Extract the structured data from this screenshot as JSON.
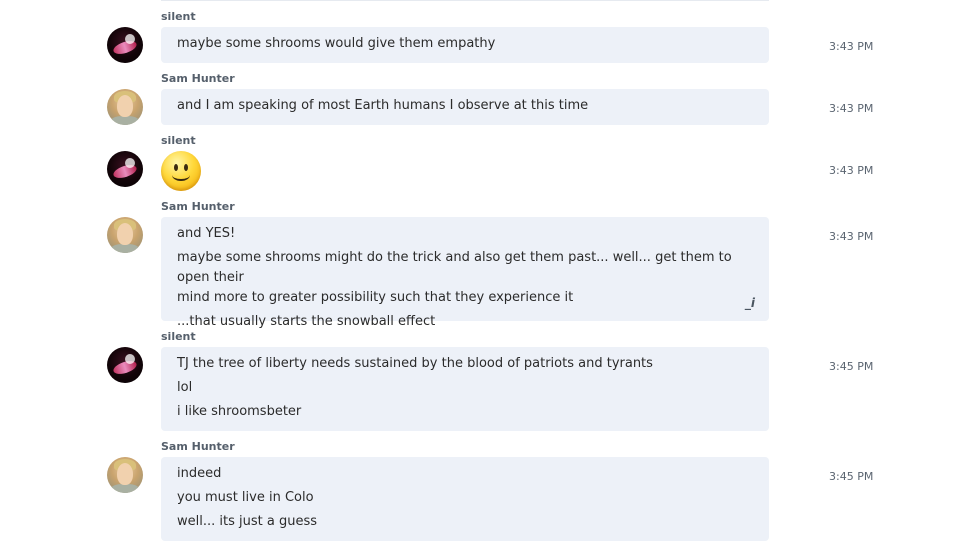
{
  "messages": [
    {
      "sender": "silent",
      "avatar": "silent-avatar",
      "time": "3:43 PM",
      "lines": [
        "maybe some shrooms would give them empathy"
      ]
    },
    {
      "sender": "Sam Hunter",
      "avatar": "sam-hunter-avatar",
      "time": "3:43 PM",
      "lines": [
        "and I am speaking of most Earth humans I observe at this time"
      ]
    },
    {
      "sender": "silent",
      "avatar": "silent-avatar",
      "time": "3:43 PM",
      "emoji": "smiley-emoji"
    },
    {
      "sender": "Sam Hunter",
      "avatar": "sam-hunter-avatar",
      "time": "3:43 PM",
      "lines": [
        "and YES!",
        "maybe some shrooms might do the trick and also get them past... well... get them to open their",
        "mind more to greater possibility such that they experience it",
        "...that usually starts the snowball effect"
      ],
      "edited_mark": "_i"
    },
    {
      "sender": "silent",
      "avatar": "silent-avatar",
      "time": "3:45 PM",
      "lines": [
        "TJ the tree of liberty needs sustained by the blood of patriots and tyrants",
        "lol",
        "i like shroomsbeter"
      ]
    },
    {
      "sender": "Sam Hunter",
      "avatar": "sam-hunter-avatar",
      "time": "3:45 PM",
      "lines": [
        "indeed",
        "you must live in Colo",
        "well... its just a guess"
      ]
    }
  ],
  "colors": {
    "bubble_bg": "#edf1f8",
    "sender_text": "#555f6b",
    "time_text": "#5a6470"
  }
}
